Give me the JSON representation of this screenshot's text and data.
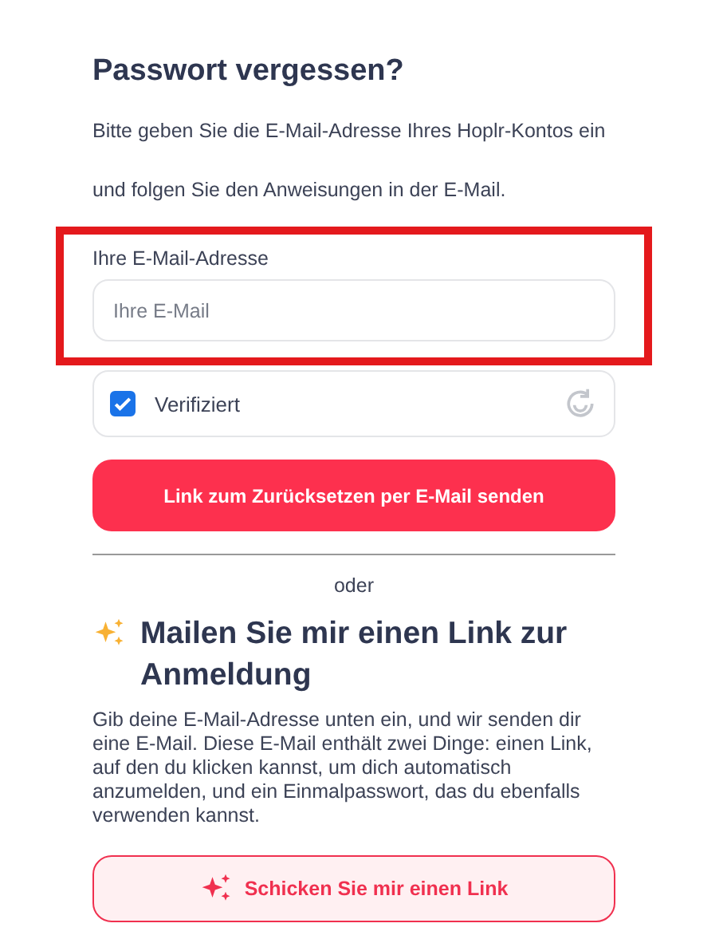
{
  "title": "Passwort vergessen?",
  "intro": "Bitte geben Sie die E-Mail-Adresse Ihres Hoplr-Kontos ein und folgen Sie den Anweisungen in der E-Mail.",
  "email_field": {
    "label": "Ihre E-Mail-Adresse",
    "placeholder": "Ihre E-Mail",
    "highlighted": true
  },
  "captcha": {
    "label": "Verifiziert",
    "checked": true
  },
  "reset_button": "Link zum Zurücksetzen per E-Mail senden",
  "separator": "oder",
  "magic_link": {
    "heading": "Mailen Sie mir einen Link zur Anmeldung",
    "description": "Gib deine E-Mail-Adresse unten ein, und wir senden dir eine E-Mail. Diese E-Mail enthält zwei Dinge: einen Link, auf den du klicken kannst, um dich automatisch anzumelden, und ein Einmalpasswort, das du ebenfalls verwenden kannst.",
    "button": "Schicken Sie mir einen Link"
  }
}
